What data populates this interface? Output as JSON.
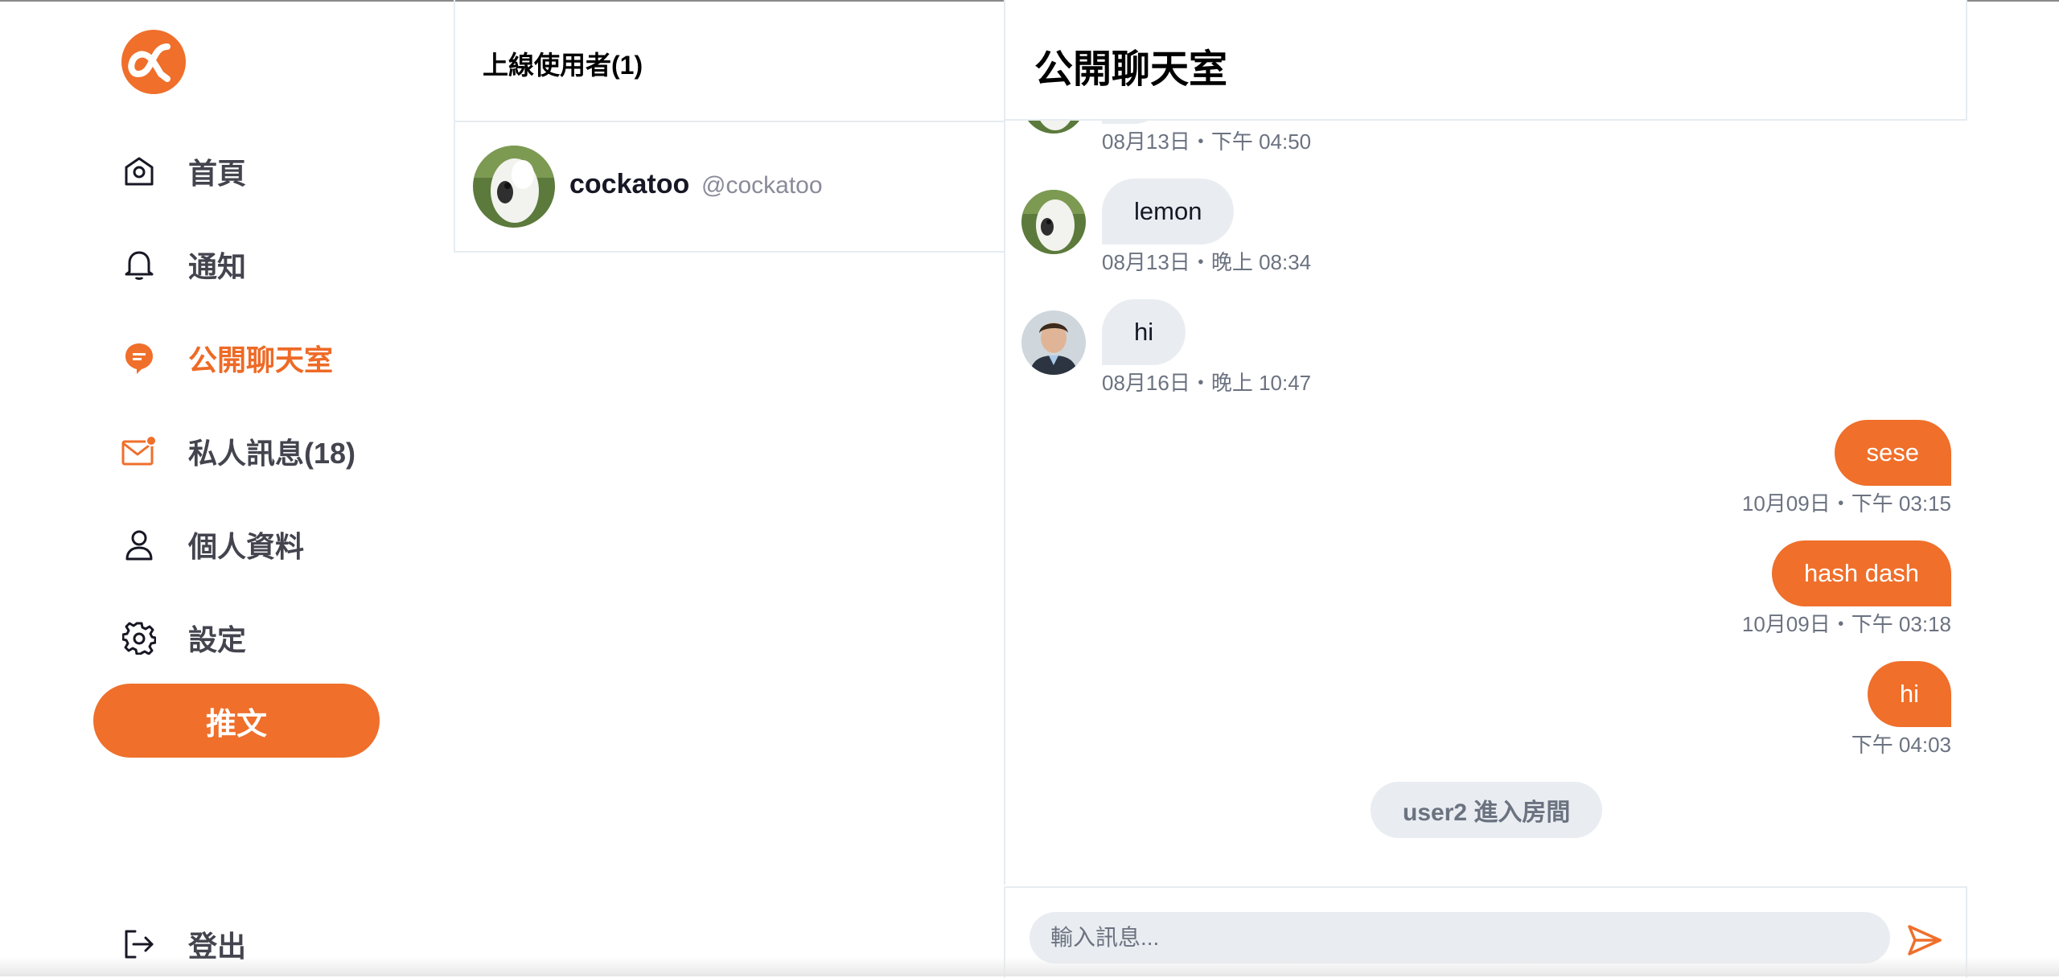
{
  "colors": {
    "accent": "#EF6F2B",
    "bubble_gray": "#E9EDF1",
    "border": "#E6ECF0",
    "muted": "#6B7280"
  },
  "sidebar": {
    "logo_icon": "alphitter-logo-icon",
    "items": [
      {
        "label": "首頁",
        "icon": "home-icon",
        "active": false
      },
      {
        "label": "通知",
        "icon": "bell-icon",
        "active": false
      },
      {
        "label": "公開聊天室",
        "icon": "chat-bubble-icon",
        "active": true
      },
      {
        "label": "私人訊息(18)",
        "icon": "mail-icon",
        "active": false
      },
      {
        "label": "個人資料",
        "icon": "user-icon",
        "active": false
      },
      {
        "label": "設定",
        "icon": "gear-icon",
        "active": false
      }
    ],
    "tweet_button": "推文",
    "logout": {
      "label": "登出",
      "icon": "logout-icon"
    }
  },
  "online": {
    "title": "上線使用者(1)",
    "users": [
      {
        "name": "cockatoo",
        "handle": "@cockatoo"
      }
    ]
  },
  "chat": {
    "title": "公開聊天室",
    "messages": [
      {
        "direction": "in",
        "text": "",
        "time": "08月13日・下午 04:50",
        "avatar": "cockatoo"
      },
      {
        "direction": "in",
        "text": "lemon",
        "time": "08月13日・晚上 08:34",
        "avatar": "cockatoo"
      },
      {
        "direction": "in",
        "text": "hi",
        "time": "08月16日・晚上 10:47",
        "avatar": "man"
      },
      {
        "direction": "out",
        "text": "sese",
        "time": "10月09日・下午 03:15"
      },
      {
        "direction": "out",
        "text": "hash dash",
        "time": "10月09日・下午 03:18"
      },
      {
        "direction": "out",
        "text": "hi",
        "time": "下午 04:03"
      }
    ],
    "system_notice": "user2 進入房間",
    "input": {
      "placeholder": "輸入訊息...",
      "value": ""
    },
    "send_icon": "send-icon"
  }
}
